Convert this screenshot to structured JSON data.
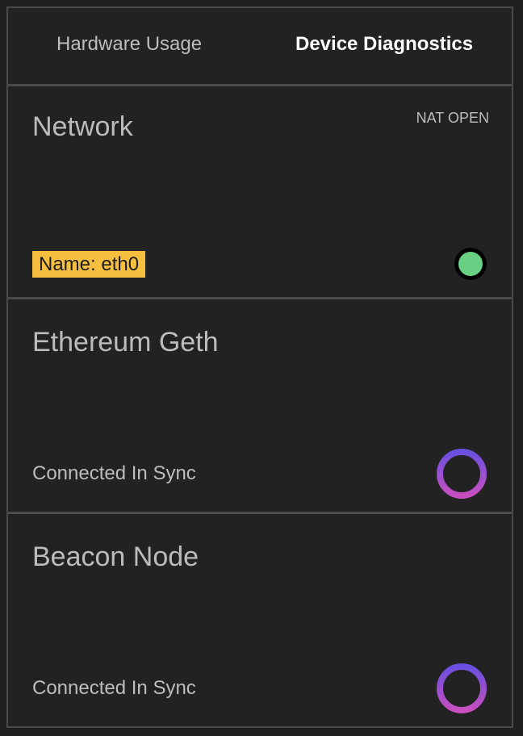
{
  "tabs": {
    "hardware_usage": "Hardware Usage",
    "device_diagnostics": "Device Diagnostics",
    "active": "Device Diagnostics"
  },
  "network": {
    "title": "Network",
    "nat_status": "NAT OPEN",
    "interface_name": "Name: eth0",
    "status_color": "#69cf83"
  },
  "geth": {
    "title": "Ethereum Geth",
    "status": "Connected In Sync"
  },
  "beacon": {
    "title": "Beacon Node",
    "status": "Connected In Sync"
  },
  "colors": {
    "background": "#222222",
    "divider": "#4a4a4a",
    "badge": "#f7bf3f",
    "ring_gradient_start": "#6a4fe0",
    "ring_gradient_end": "#c84fc0"
  }
}
